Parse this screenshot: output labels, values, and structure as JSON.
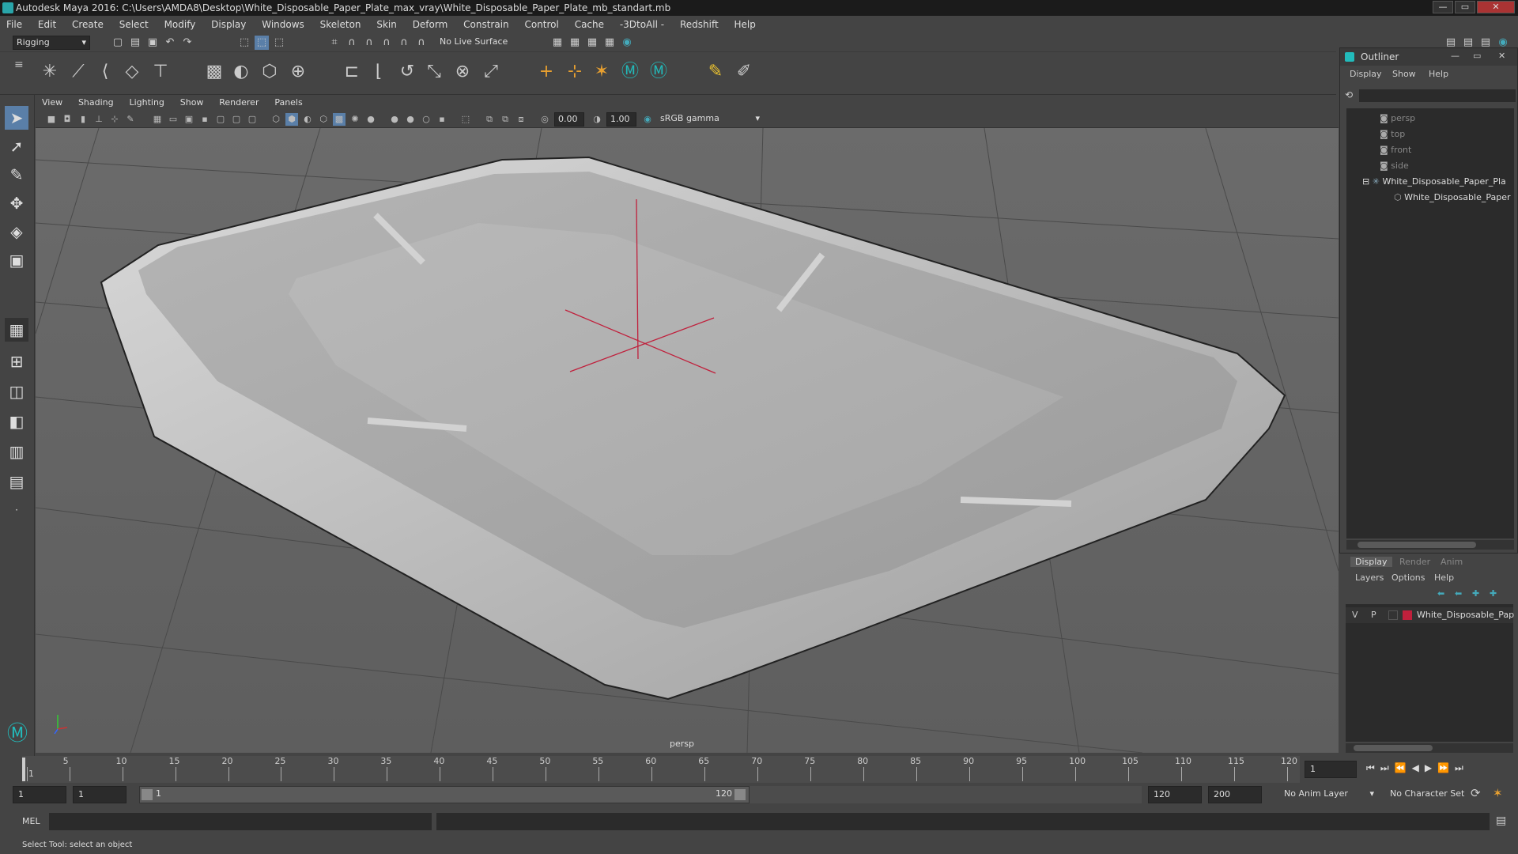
{
  "window": {
    "title": "Autodesk Maya 2016: C:\\Users\\AMDA8\\Desktop\\White_Disposable_Paper_Plate_max_vray\\White_Disposable_Paper_Plate_mb_standart.mb",
    "min": "—",
    "max": "▭",
    "close": "✕"
  },
  "menubar": [
    "File",
    "Edit",
    "Create",
    "Select",
    "Modify",
    "Display",
    "Windows",
    "Skeleton",
    "Skin",
    "Deform",
    "Constrain",
    "Control",
    "Cache",
    "-3DtoAll -",
    "Redshift",
    "Help"
  ],
  "toolbar": {
    "mode": "Rigging",
    "live_surface": "No Live Surface"
  },
  "viewport": {
    "menus": [
      "View",
      "Shading",
      "Lighting",
      "Show",
      "Renderer",
      "Panels"
    ],
    "exposure": "0.00",
    "gamma": "1.00",
    "colorspace": "sRGB gamma",
    "camera_label": "persp"
  },
  "outliner": {
    "title": "Outliner",
    "menus": [
      "Display",
      "Show",
      "Help"
    ],
    "items": [
      "persp",
      "top",
      "front",
      "side",
      "White_Disposable_Paper_Pla",
      "White_Disposable_Paper"
    ]
  },
  "layers": {
    "tabs": [
      "Display",
      "Render",
      "Anim"
    ],
    "menus": [
      "Layers",
      "Options",
      "Help"
    ],
    "row": {
      "v": "V",
      "p": "P",
      "name": "White_Disposable_Pap"
    },
    "layer_color": "#c0203c"
  },
  "timeline": {
    "ticks": [
      "1",
      "5",
      "10",
      "15",
      "20",
      "25",
      "30",
      "35",
      "40",
      "45",
      "50",
      "55",
      "60",
      "65",
      "70",
      "75",
      "80",
      "85",
      "90",
      "95",
      "100",
      "105",
      "110",
      "115",
      "120"
    ],
    "current_frame": "1"
  },
  "range": {
    "start": "1",
    "start2": "1",
    "slider_start": "1",
    "slider_end": "120",
    "end": "120",
    "max_end": "200",
    "anim_layer": "No Anim Layer",
    "char_set": "No Character Set"
  },
  "cmd": {
    "label": "MEL"
  },
  "help": {
    "text": "Select Tool: select an object"
  }
}
